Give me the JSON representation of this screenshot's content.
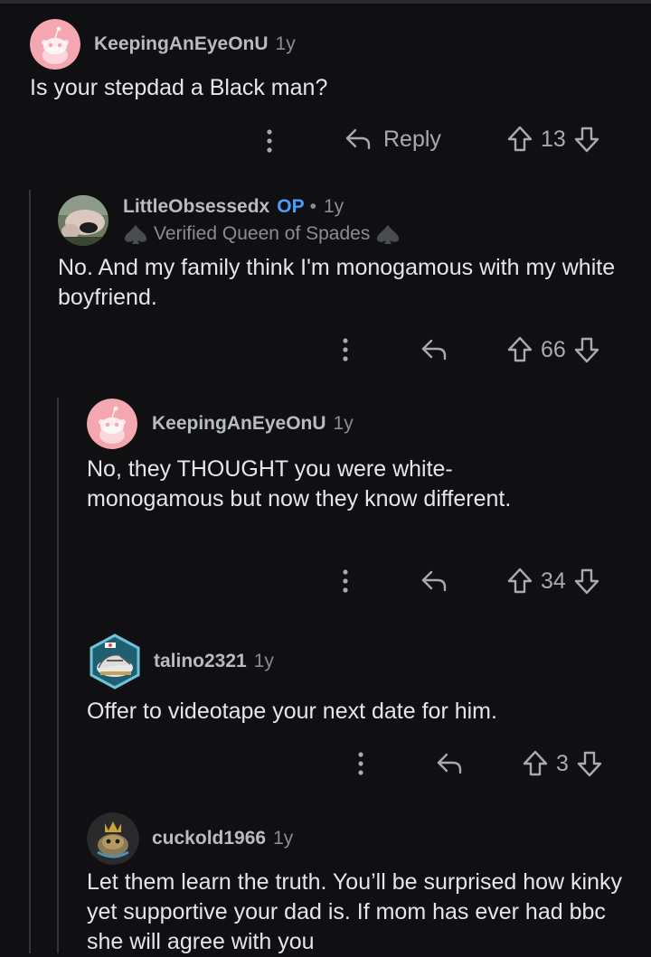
{
  "comments": [
    {
      "author": "KeepingAnEyeOnU",
      "time": "1y",
      "body": "Is your stepdad a Black man?",
      "reply_label": "Reply",
      "score": "13",
      "avatar": "snoo-pink"
    },
    {
      "author": "LittleObsessedx",
      "op_badge": "OP",
      "separator": "•",
      "time": "1y",
      "flair": "Verified Queen of Spades",
      "body": "No. And my family think I'm monogamous with my white boyfriend.",
      "score": "66",
      "avatar": "photo"
    },
    {
      "author": "KeepingAnEyeOnU",
      "time": "1y",
      "body": "No, they THOUGHT you were white-monogamous but now they know different.",
      "score": "34",
      "avatar": "snoo-pink"
    },
    {
      "author": "talino2321",
      "time": "1y",
      "body": "Offer to videotape your next date for him.",
      "score": "3",
      "avatar": "snoo-sneaker-hexagon"
    },
    {
      "author": "cuckold1966",
      "time": "1y",
      "body": "Let them learn the truth. You’ll be surprised how kinky yet supportive your dad is. If mom has ever had bbc she will agree with you",
      "avatar": "snoo-gold-crown"
    }
  ],
  "colors": {
    "background": "#101012",
    "op_badge": "#4a9dfa",
    "avatar_pink": "#f4a7b0",
    "text": "#e4e6e8",
    "meta": "#8a8d90"
  }
}
